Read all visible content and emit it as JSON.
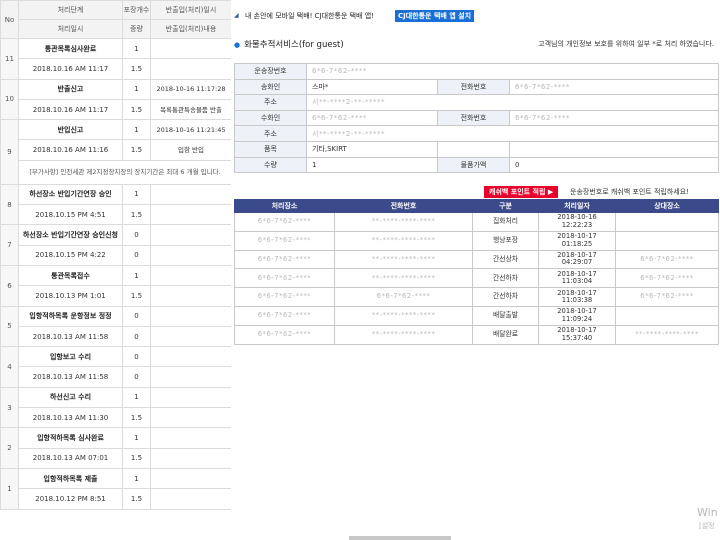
{
  "left": {
    "header": {
      "no": "No",
      "process_step": "처리단계",
      "package_count": "포장개수",
      "release_datetime": "반출입(처리)일시",
      "process_datetime": "처리일시",
      "weight": "중량",
      "release_content": "반출입(처리)내용"
    },
    "groups": [
      {
        "no": "11",
        "step": "통관목록심사완료",
        "count": "1",
        "datetime": "2018.10.16 AM 11:17",
        "weight": "1.5",
        "release_dt": "",
        "release_content": ""
      },
      {
        "no": "10",
        "step": "반출신고",
        "count": "1",
        "datetime": "2018.10.16 AM 11:17",
        "weight": "1.5",
        "release_dt": "2018-10-16 11:17:28",
        "release_content": "목록통관특송물품 반출"
      },
      {
        "no": "9",
        "step": "반입신고",
        "count": "1",
        "datetime": "2018.10.16 AM 11:16",
        "weight": "1.5",
        "release_dt": "2018-10-16 11:21:45",
        "release_content": "입항 반입"
      },
      {
        "no": "8",
        "step": "하선장소 반입기간연장 승인",
        "count": "1",
        "datetime": "2018.10.15 PM 4:51",
        "weight": "1.5",
        "release_dt": "",
        "release_content": ""
      },
      {
        "no": "7",
        "step": "하선장소 반입기간연장 승인신청",
        "count": "0",
        "datetime": "2018.10.15 PM 4:22",
        "weight": "0",
        "release_dt": "",
        "release_content": ""
      },
      {
        "no": "6",
        "step": "통관목록접수",
        "count": "1",
        "datetime": "2018.10.13 PM 1:01",
        "weight": "1.5",
        "release_dt": "",
        "release_content": ""
      },
      {
        "no": "5",
        "step": "입항적하목록 운항정보 정정",
        "count": "0",
        "datetime": "2018.10.13 AM 11:58",
        "weight": "0",
        "release_dt": "",
        "release_content": ""
      },
      {
        "no": "4",
        "step": "입항보고 수리",
        "count": "0",
        "datetime": "2018.10.13 AM 11:58",
        "weight": "0",
        "release_dt": "",
        "release_content": ""
      },
      {
        "no": "3",
        "step": "하선신고 수리",
        "count": "1",
        "datetime": "2018.10.13 AM 11:30",
        "weight": "1.5",
        "release_dt": "",
        "release_content": ""
      },
      {
        "no": "2",
        "step": "입항적하목록 심사완료",
        "count": "1",
        "datetime": "2018.10.13 AM 07:01",
        "weight": "1.5",
        "release_dt": "",
        "release_content": ""
      },
      {
        "no": "1",
        "step": "입항적하목록 제출",
        "count": "1",
        "datetime": "2018.10.12 PM 8:51",
        "weight": "1.5",
        "release_dt": "",
        "release_content": ""
      }
    ],
    "note": "[부가사항] 인천세관 제2지정장치장의 장치기간은 최대 6 개월 입니다."
  },
  "topbar": {
    "message": "내 손안에 모바일 택배! CJ대한통운 택배 앱!",
    "install_label": "CJ대한통운 택배 앱 설치"
  },
  "service": {
    "title": "화물추적서비스(for guest)",
    "privacy_note": "고객님의 개인정보 보호를 위하여 일부 *로 처리 하였습니다."
  },
  "info": {
    "labels": {
      "invoice": "운송장번호",
      "sender": "송화인",
      "phone": "전화번호",
      "address": "주소",
      "receiver": "수화인",
      "item": "품목",
      "qty": "수량",
      "cod": "물품가액"
    },
    "values": {
      "invoice": "6*6-7*62-****",
      "sender": "스마*",
      "sender_phone": "6*6-7*62-****",
      "sender_address": "서**-****2-**-*****",
      "receiver": "6*6-7*62-****",
      "receiver_phone": "6*6-7*62-****",
      "receiver_address": "서**-****2-**-*****",
      "item": "기타,SKIRT",
      "qty": "1",
      "cod": "0"
    }
  },
  "points": {
    "button_label": "캐쉬백 포인트 적립 ▶",
    "text": "운송장번호로 캐쉬백 포인트 적립하세요!"
  },
  "track": {
    "headers": [
      "처리장소",
      "전화번호",
      "구분",
      "처리일자",
      "상대장소"
    ],
    "rows": [
      {
        "place": "6*6-7*62-****",
        "phone": "**-****-****-****",
        "kind": "집화처리",
        "date": "2018-10-16",
        "time": "12:22:23",
        "other": ""
      },
      {
        "place": "6*6-7*62-****",
        "phone": "**-****-****-****",
        "kind": "행낭포장",
        "date": "2018-10-17",
        "time": "01:18:25",
        "other": ""
      },
      {
        "place": "6*6-7*62-****",
        "phone": "**-****-****-****",
        "kind": "간선상차",
        "date": "2018-10-17",
        "time": "04:29:07",
        "other": "6*6-7*62-****"
      },
      {
        "place": "6*6-7*62-****",
        "phone": "**-****-****-****",
        "kind": "간선하차",
        "date": "2018-10-17",
        "time": "11:03:04",
        "other": "6*6-7*62-****"
      },
      {
        "place": "6*6-7*62-****",
        "phone": "6*6-7*62-****",
        "kind": "간선하차",
        "date": "2018-10-17",
        "time": "11:03:38",
        "other": "6*6-7*62-****"
      },
      {
        "place": "6*6-7*62-****",
        "phone": "**-****-****-****",
        "kind": "배달출발",
        "date": "2018-10-17",
        "time": "11:09:24",
        "other": ""
      },
      {
        "place": "6*6-7*62-****",
        "phone": "**-****-****-****",
        "kind": "배달완료",
        "date": "2018-10-17",
        "time": "15:37:40",
        "other": "**-****-****-****"
      }
    ]
  },
  "watermark": {
    "line1": "Win",
    "line2": "[설정"
  }
}
